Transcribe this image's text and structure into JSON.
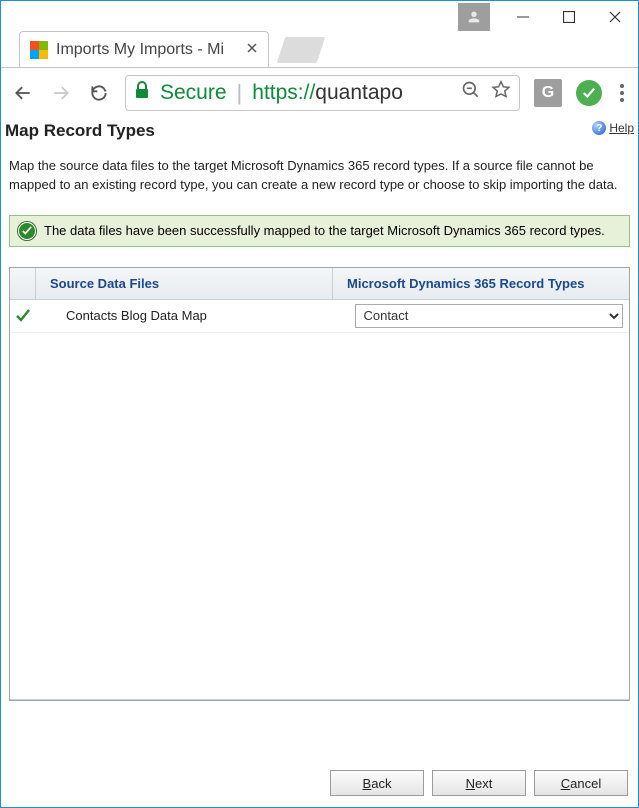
{
  "browser": {
    "tab_title": "Imports My Imports - Mi",
    "url_proto": "https://",
    "url_rest": "quantapo",
    "secure_label": "Secure",
    "g_badge": "G"
  },
  "page": {
    "title": "Map Record Types",
    "help_label": "Help",
    "help_questionmark": "?",
    "intro": "Map the source data files to the target Microsoft Dynamics 365 record types. If a source file cannot be mapped to an existing record type, you can create a new record type or choose to skip importing the data."
  },
  "banner": {
    "message": "The data files have been successfully mapped to the target Microsoft Dynamics 365 record types."
  },
  "grid": {
    "col1": "Source Data Files",
    "col2": "Microsoft Dynamics 365 Record Types",
    "rows": [
      {
        "file": "Contacts Blog Data Map",
        "recordType": "Contact"
      }
    ]
  },
  "footer": {
    "back": "Back",
    "next": "Next",
    "cancel": "Cancel",
    "back_mn": "B",
    "back_rest": "ack",
    "next_mn": "N",
    "next_rest": "ext",
    "cancel_mn": "C",
    "cancel_rest": "ancel"
  }
}
